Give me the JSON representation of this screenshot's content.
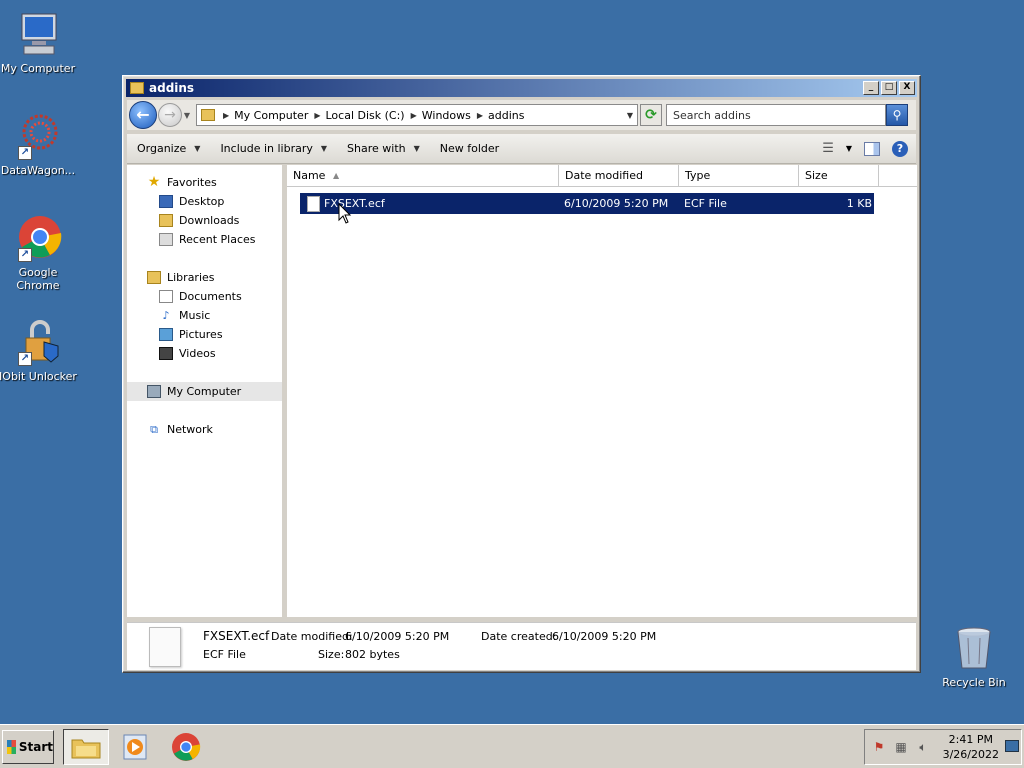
{
  "desktop": {
    "icons": [
      {
        "label": "My Computer"
      },
      {
        "label": "DataWagon..."
      },
      {
        "label": "Google Chrome"
      },
      {
        "label": "IObit Unlocker"
      },
      {
        "label": "Recycle Bin"
      }
    ]
  },
  "window": {
    "title": "addins",
    "controls": {
      "minimize": "_",
      "maximize": "□",
      "close": "X"
    }
  },
  "address": {
    "crumbs": [
      "My Computer",
      "Local Disk (C:)",
      "Windows",
      "addins"
    ],
    "search_placeholder": "Search addins"
  },
  "toolbar": {
    "organize": "Organize",
    "include_in_library": "Include in library",
    "share_with": "Share with",
    "new_folder": "New folder"
  },
  "navpane": {
    "favorites": "Favorites",
    "desktop": "Desktop",
    "downloads": "Downloads",
    "recent_places": "Recent Places",
    "libraries": "Libraries",
    "documents": "Documents",
    "music": "Music",
    "pictures": "Pictures",
    "videos": "Videos",
    "my_computer": "My Computer",
    "network": "Network"
  },
  "columns": {
    "name": "Name",
    "date_modified": "Date modified",
    "type": "Type",
    "size": "Size"
  },
  "files": [
    {
      "name": "FXSEXT.ecf",
      "date_modified": "6/10/2009 5:20 PM",
      "type": "ECF File",
      "size": "1 KB"
    }
  ],
  "details": {
    "filename": "FXSEXT.ecf",
    "filetype": "ECF File",
    "date_modified_label": "Date modified:",
    "date_modified": "6/10/2009 5:20 PM",
    "date_created_label": "Date created:",
    "date_created": "6/10/2009 5:20 PM",
    "size_label": "Size:",
    "size": "802 bytes"
  },
  "taskbar": {
    "start_label": "Start",
    "clock_time": "2:41 PM",
    "clock_date": "3/26/2022"
  },
  "colors": {
    "desktop_bg": "#3a6ea5",
    "titlebar": "#0a246a",
    "selection": "#0a246a"
  }
}
